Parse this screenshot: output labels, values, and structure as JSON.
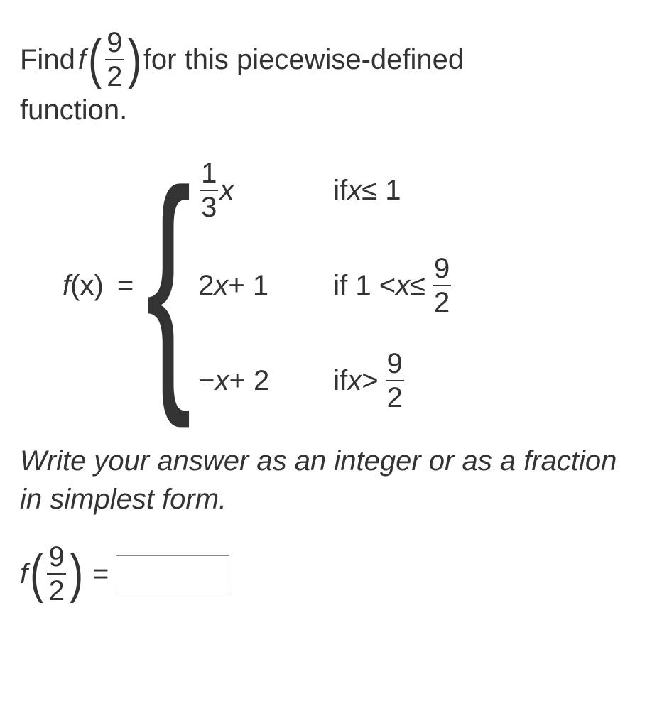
{
  "prompt": {
    "pre": "Find ",
    "f": "f",
    "arg_num": "9",
    "arg_den": "2",
    "post": " for this piecewise-defined",
    "line2": "function."
  },
  "piecewise": {
    "lhs_f": "f",
    "lhs_x": "(x)",
    "eq": "=",
    "brace": "{",
    "cases": [
      {
        "expr": {
          "coef_num": "1",
          "coef_den": "3",
          "var": "x"
        },
        "cond": {
          "pre": "if ",
          "var": "x",
          "rel": " ≤ 1"
        }
      },
      {
        "expr": {
          "text": "2",
          "var": "x",
          "tail": " + 1"
        },
        "cond": {
          "pre": "if 1 < ",
          "var": "x",
          "rel": " ≤ ",
          "rhs_num": "9",
          "rhs_den": "2"
        }
      },
      {
        "expr": {
          "neg": "−",
          "var": "x",
          "tail": " + 2"
        },
        "cond": {
          "pre": "if ",
          "var": "x",
          "rel": " > ",
          "rhs_num": "9",
          "rhs_den": "2"
        }
      }
    ]
  },
  "instruction": "Write your answer as an integer or as a fraction in simplest form.",
  "answer": {
    "f": "f",
    "arg_num": "9",
    "arg_den": "2",
    "eq": "=",
    "value": "",
    "placeholder": ""
  }
}
